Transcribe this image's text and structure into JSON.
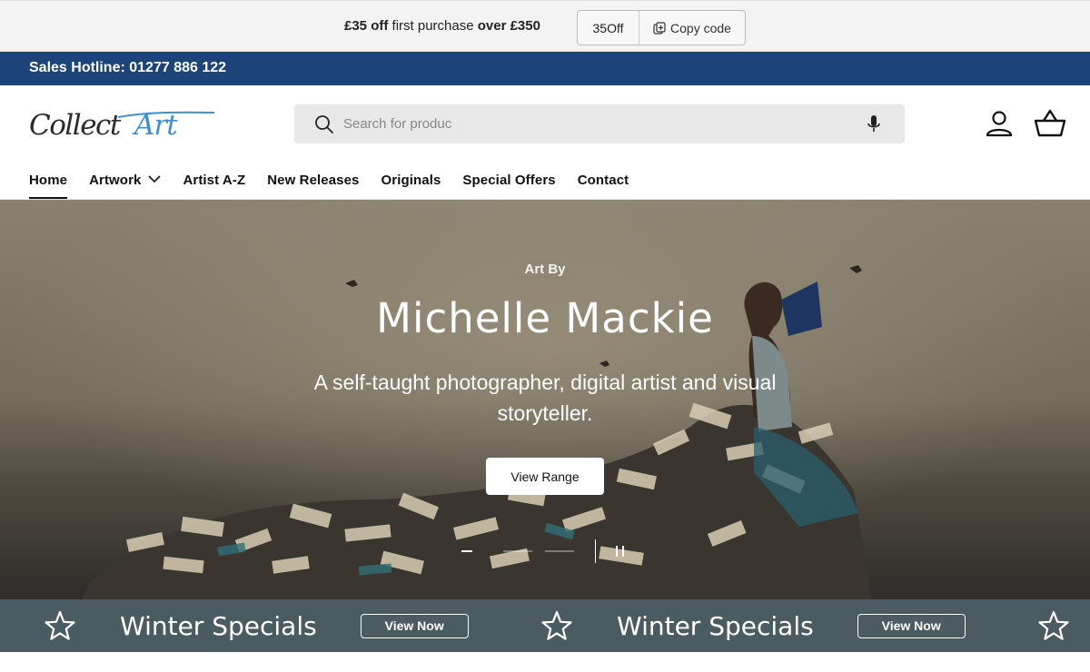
{
  "promo": {
    "amount": "£35 off",
    "middle": " first purchase ",
    "condition": "over £350",
    "code": "35Off",
    "copy_label": "Copy code"
  },
  "hotline": {
    "text": "Sales Hotline: 01277 886 122"
  },
  "logo": {
    "part1": "Collect",
    "part2": "Art"
  },
  "search": {
    "placeholder": "Search for produc"
  },
  "nav": {
    "items": [
      {
        "label": "Home"
      },
      {
        "label": "Artwork"
      },
      {
        "label": "Artist A-Z"
      },
      {
        "label": "New Releases"
      },
      {
        "label": "Originals"
      },
      {
        "label": "Special Offers"
      },
      {
        "label": "Contact"
      }
    ]
  },
  "hero": {
    "kicker": "Art By",
    "title": "Michelle Mackie",
    "subtitle": "A self-taught photographer, digital artist and visual storyteller.",
    "button": "View Range"
  },
  "marquee": {
    "items": [
      {
        "text": "Winter Specials",
        "button": "View Now"
      },
      {
        "text": "Winter Specials",
        "button": "View Now"
      }
    ]
  },
  "colors": {
    "hotline_bg": "#1c4478",
    "marquee_bg": "#4a5b62",
    "promo_bg": "#f3f3f3"
  },
  "icons": [
    "copy-icon",
    "search-icon",
    "microphone-icon",
    "account-icon",
    "basket-icon",
    "chevron-down-icon",
    "pause-icon",
    "star-icon"
  ]
}
